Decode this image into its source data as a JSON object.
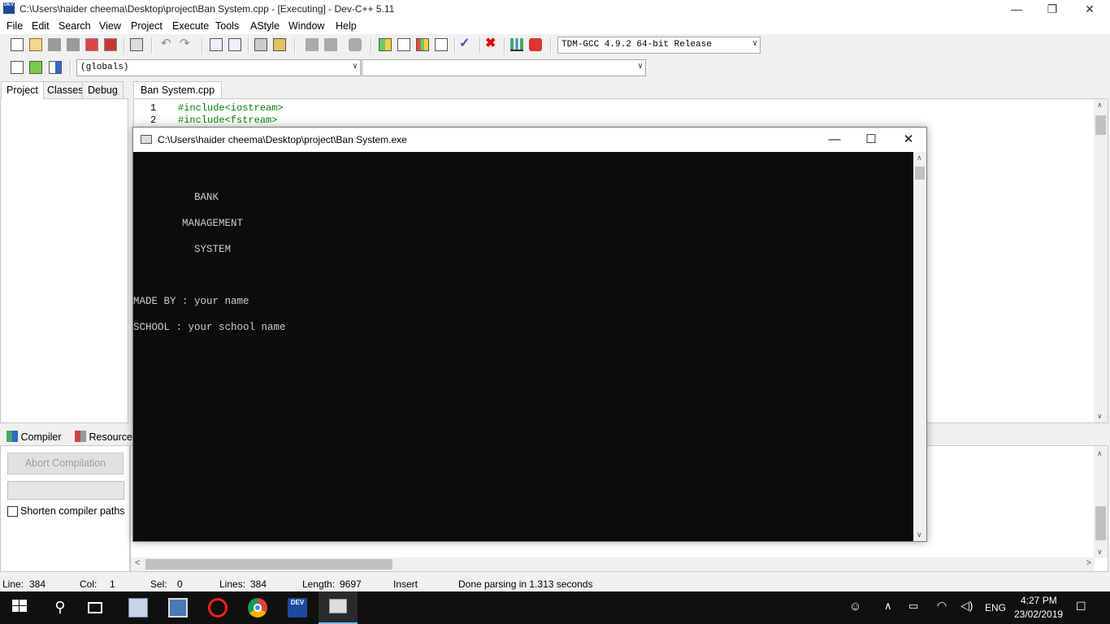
{
  "window": {
    "title": "C:\\Users\\haider cheema\\Desktop\\project\\Ban System.cpp - [Executing] - Dev-C++ 5.11",
    "app_icon_text": "DEV"
  },
  "menu": [
    "File",
    "Edit",
    "Search",
    "View",
    "Project",
    "Execute",
    "Tools",
    "AStyle",
    "Window",
    "Help"
  ],
  "toolbar": {
    "compiler_select": "TDM-GCC 4.9.2 64-bit Release",
    "scope_select": "(globals)",
    "member_select": ""
  },
  "left_tabs": [
    "Project",
    "Classes",
    "Debug"
  ],
  "editor": {
    "tab": "Ban System.cpp",
    "lines": [
      {
        "num": "1",
        "code": "#include<iostream>"
      },
      {
        "num": "2",
        "code": "#include<fstream>"
      }
    ]
  },
  "console": {
    "title": "C:\\Users\\haider cheema\\Desktop\\project\\Ban System.exe",
    "lines": [
      "          BANK",
      "        MANAGEMENT",
      "          SYSTEM",
      "MADE BY : your name",
      "SCHOOL : your school name"
    ]
  },
  "bottom": {
    "tabs": [
      "Compiler",
      "Resources"
    ],
    "abort_button": "Abort Compilation",
    "shorten_label": "Shorten compiler paths"
  },
  "status": {
    "line_label": "Line:",
    "line_value": "384",
    "col_label": "Col:",
    "col_value": "1",
    "sel_label": "Sel:",
    "sel_value": "0",
    "lines_label": "Lines:",
    "lines_value": "384",
    "length_label": "Length:",
    "length_value": "9697",
    "mode": "Insert",
    "message": "Done parsing in 1.313 seconds"
  },
  "taskbar": {
    "devcpp_label": "DEV",
    "lang": "ENG",
    "time": "4:27 PM",
    "date": "23/02/2019"
  }
}
